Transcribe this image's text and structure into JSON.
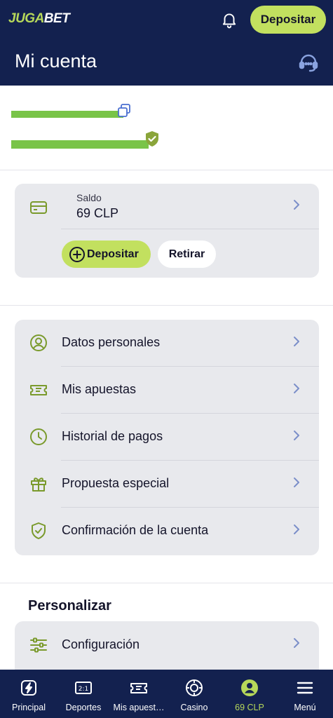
{
  "header": {
    "logo_part1": "JUGA",
    "logo_part2": "BET",
    "deposit_label": "Depositar",
    "page_title": "Mi cuenta"
  },
  "balance": {
    "label": "Saldo",
    "value": "69 CLP",
    "deposit_label": "Depositar",
    "withdraw_label": "Retirar"
  },
  "menu": {
    "items": [
      {
        "label": "Datos personales",
        "icon": "user-circle-icon"
      },
      {
        "label": "Mis apuestas",
        "icon": "ticket-icon"
      },
      {
        "label": "Historial de pagos",
        "icon": "clock-icon"
      },
      {
        "label": "Propuesta especial",
        "icon": "gift-icon"
      },
      {
        "label": "Confirmación de la cuenta",
        "icon": "shield-check-icon"
      }
    ]
  },
  "personalize": {
    "title": "Personalizar",
    "items": [
      {
        "label": "Configuración",
        "icon": "sliders-icon"
      }
    ]
  },
  "bottom_nav": {
    "items": [
      {
        "label": "Principal",
        "icon": "lightning-icon"
      },
      {
        "label": "Deportes",
        "icon": "scoreboard-icon"
      },
      {
        "label": "Mis apuest…",
        "icon": "ticket-icon"
      },
      {
        "label": "Casino",
        "icon": "chip-icon"
      },
      {
        "label": "69 CLP",
        "icon": "user-icon",
        "active": true
      },
      {
        "label": "Menú",
        "icon": "hamburger-icon"
      }
    ]
  },
  "colors": {
    "navy": "#13214f",
    "accent_green": "#c2e05f",
    "icon_green": "#7a9a2c",
    "chevron_blue": "#7b8fc9",
    "card_bg": "#e8e9ed"
  }
}
